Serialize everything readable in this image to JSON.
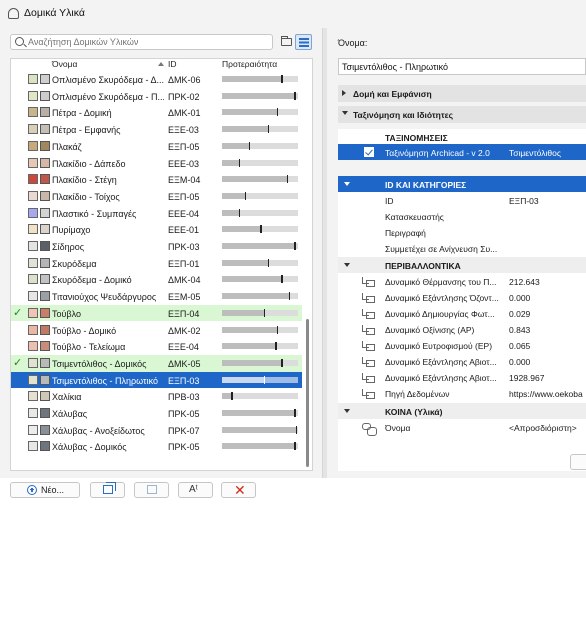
{
  "window": {
    "title": "Δομικά Υλικά"
  },
  "search": {
    "placeholder": "Αναζήτηση Δομικών Υλικών"
  },
  "table": {
    "headers": {
      "name": "Όνομα",
      "id": "ID",
      "priority": "Προτεραιότητα"
    },
    "rows": [
      {
        "name": "Οπλισμένο Σκυρόδεμα - Δ...",
        "id": "ΔΜΚ-06",
        "priority": 0.78,
        "check": false,
        "state": "",
        "c1": "#d8e3c4",
        "c2": "#cfcfcf"
      },
      {
        "name": "Οπλισμένο Σκυρόδεμα - Π...",
        "id": "ΠΡΚ-02",
        "priority": 0.95,
        "check": false,
        "state": "",
        "c1": "#dfe7c9",
        "c2": "#cccccc"
      },
      {
        "name": "Πέτρα - Δομική",
        "id": "ΔΜΚ-01",
        "priority": 0.72,
        "check": false,
        "state": "",
        "c1": "#c9b58a",
        "c2": "#b8b0a6"
      },
      {
        "name": "Πέτρα - Εμφανής",
        "id": "ΕΞΕ-03",
        "priority": 0.6,
        "check": false,
        "state": "",
        "c1": "#d8cfb8",
        "c2": "#c4bfb6"
      },
      {
        "name": "Πλακάζ",
        "id": "ΕΞΠ-05",
        "priority": 0.35,
        "check": false,
        "state": "",
        "c1": "#c9a97c",
        "c2": "#a2865d"
      },
      {
        "name": "Πλακίδιο - Δάπεδο",
        "id": "ΕΕΕ-03",
        "priority": 0.22,
        "check": false,
        "state": "",
        "c1": "#e8c7b4",
        "c2": "#d7b6a8"
      },
      {
        "name": "Πλακίδιο - Στέγη",
        "id": "ΕΞΜ-04",
        "priority": 0.85,
        "check": false,
        "state": "",
        "c1": "#c94a3d",
        "c2": "#c0574b"
      },
      {
        "name": "Πλακίδιο - Τοίχος",
        "id": "ΕΞΠ-05",
        "priority": 0.3,
        "check": false,
        "state": "",
        "c1": "#e9d9d0",
        "c2": "#c9b5aa"
      },
      {
        "name": "Πλαστικό - Συμπαγές",
        "id": "ΕΕΕ-04",
        "priority": 0.22,
        "check": false,
        "state": "",
        "c1": "#a8a8f0",
        "c2": "#d4d4d4"
      },
      {
        "name": "Πυρίμαχο",
        "id": "ΕΕΕ-01",
        "priority": 0.5,
        "check": false,
        "state": "",
        "c1": "#f1e2c6",
        "c2": "#dad4ca"
      },
      {
        "name": "Σίδηρος",
        "id": "ΠΡΚ-03",
        "priority": 0.95,
        "check": false,
        "state": "",
        "c1": "#e4e4e4",
        "c2": "#5b6068"
      },
      {
        "name": "Σκυρόδεμα",
        "id": "ΕΞΠ-01",
        "priority": 0.6,
        "check": false,
        "state": "",
        "c1": "#e0e4d4",
        "c2": "#b5b5b5"
      },
      {
        "name": "Σκυρόδεμα - Δομικό",
        "id": "ΔΜΚ-04",
        "priority": 0.78,
        "check": false,
        "state": "",
        "c1": "#dbe2cc",
        "c2": "#c2c2c2"
      },
      {
        "name": "Τιτανιούχος Ψευδάργυρος",
        "id": "ΕΞΜ-05",
        "priority": 0.88,
        "check": false,
        "state": "",
        "c1": "#e6e6e6",
        "c2": "#9aa0a6"
      },
      {
        "name": "Τούβλο",
        "id": "ΕΞΠ-04",
        "priority": 0.55,
        "check": true,
        "state": "hl",
        "c1": "#f0c5b5",
        "c2": "#c97f67"
      },
      {
        "name": "Τούβλο - Δομικό",
        "id": "ΔΜΚ-02",
        "priority": 0.72,
        "check": false,
        "state": "",
        "c1": "#e9b7a4",
        "c2": "#c07a63"
      },
      {
        "name": "Τούβλο - Τελείωμα",
        "id": "ΕΞΕ-04",
        "priority": 0.7,
        "check": false,
        "state": "",
        "c1": "#ecbfb0",
        "c2": "#c98c7a"
      },
      {
        "name": "Τσιμεντόλιθος - Δομικός",
        "id": "ΔΜΚ-05",
        "priority": 0.78,
        "check": true,
        "state": "hl",
        "c1": "#dfe3cf",
        "c2": "#b9b9b9"
      },
      {
        "name": "Τσιμεντόλιθος - Πληρωτικό",
        "id": "ΕΞΠ-03",
        "priority": 0.55,
        "check": false,
        "state": "sel",
        "c1": "#dfe3cf",
        "c2": "#b9b9b9"
      },
      {
        "name": "Χαλίκια",
        "id": "ΠΡΒ-03",
        "priority": 0.12,
        "check": false,
        "state": "",
        "c1": "#e5e0d2",
        "c2": "#cfc8b8"
      },
      {
        "name": "Χάλυβας",
        "id": "ΠΡΚ-05",
        "priority": 0.95,
        "check": false,
        "state": "",
        "c1": "#e8e8e8",
        "c2": "#6f757c"
      },
      {
        "name": "Χάλυβας - Ανοξείδωτος",
        "id": "ΠΡΚ-07",
        "priority": 0.97,
        "check": false,
        "state": "",
        "c1": "#ececec",
        "c2": "#8b9096"
      },
      {
        "name": "Χάλυβας - Δομικός",
        "id": "ΠΡΚ-05",
        "priority": 0.95,
        "check": false,
        "state": "",
        "c1": "#e8e8e8",
        "c2": "#6f757c"
      }
    ]
  },
  "buttons": {
    "new_label": "Νέο..."
  },
  "details": {
    "name_label": "Όνομα:",
    "name_value": "Τσιμεντόλιθος - Πληρωτικό",
    "sections": {
      "structure": "Δομή και Εμφάνιση",
      "classification": "Ταξινόμηση και Ιδιότητες"
    },
    "classifications_header": "ΤΑΞΙΝΟΜΗΣΕΙΣ",
    "classification_row": {
      "label": "Ταξινόμηση Archicad - v 2.0",
      "value": "Τσιμεντόλιθος"
    },
    "id_group": "ID ΚΑΙ ΚΑΤΗΓΟΡΙΕΣ",
    "id_rows": [
      {
        "label": "ID",
        "value": "ΕΞΠ-03"
      },
      {
        "label": "Κατασκευαστής",
        "value": ""
      },
      {
        "label": "Περιγραφή",
        "value": ""
      },
      {
        "label": "Συμμετέχει σε Ανίχνευση Συ...",
        "value": ""
      }
    ],
    "env_group": "ΠΕΡΙΒΑΛΛΟΝΤΙΚΑ",
    "env_rows": [
      {
        "label": "Δυναμικό Θέρμανσης του Π...",
        "value": "212.643"
      },
      {
        "label": "Δυναμικό Εξάντλησης Όζοντ...",
        "value": "0.000"
      },
      {
        "label": "Δυναμικό Δημιουργίας Φωτ...",
        "value": "0.029"
      },
      {
        "label": "Δυναμικό Οξίνισης (AP)",
        "value": "0.843"
      },
      {
        "label": "Δυναμικό Ευτροφισμού (EP)",
        "value": "0.065"
      },
      {
        "label": "Δυναμικό Εξάντλησης Αβιοτ...",
        "value": "0.000"
      },
      {
        "label": "Δυναμικό Εξάντλησης Αβιοτ...",
        "value": "1928.967"
      },
      {
        "label": "Πηγή Δεδομένων",
        "value": "https://www.oekoba"
      }
    ],
    "common_group": "ΚΟΙΝΑ (Υλικά)",
    "common_row": {
      "label": "Όνομα",
      "value": "<Απροσδιόριστη>"
    }
  }
}
